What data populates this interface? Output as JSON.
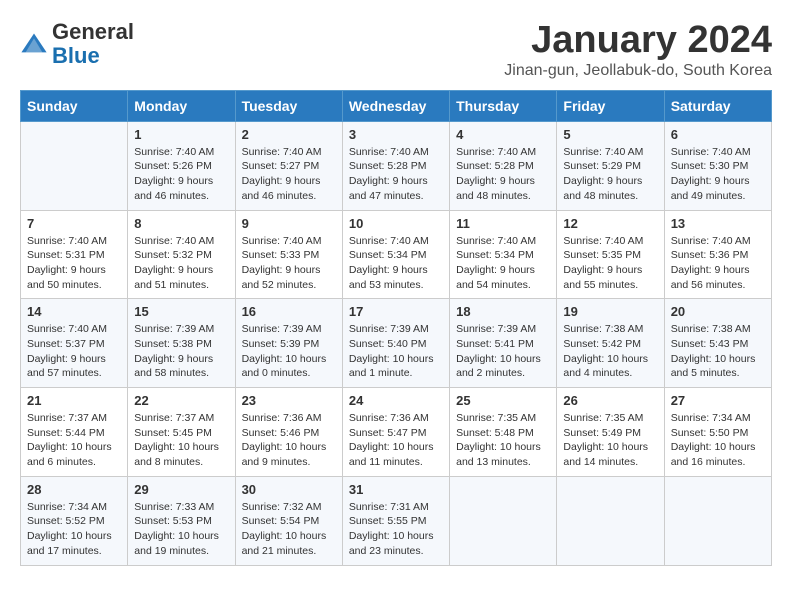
{
  "header": {
    "logo_line1": "General",
    "logo_line2": "Blue",
    "month_title": "January 2024",
    "subtitle": "Jinan-gun, Jeollabuk-do, South Korea"
  },
  "weekdays": [
    "Sunday",
    "Monday",
    "Tuesday",
    "Wednesday",
    "Thursday",
    "Friday",
    "Saturday"
  ],
  "weeks": [
    [
      {
        "day": "",
        "sunrise": "",
        "sunset": "",
        "daylight": ""
      },
      {
        "day": "1",
        "sunrise": "Sunrise: 7:40 AM",
        "sunset": "Sunset: 5:26 PM",
        "daylight": "Daylight: 9 hours and 46 minutes."
      },
      {
        "day": "2",
        "sunrise": "Sunrise: 7:40 AM",
        "sunset": "Sunset: 5:27 PM",
        "daylight": "Daylight: 9 hours and 46 minutes."
      },
      {
        "day": "3",
        "sunrise": "Sunrise: 7:40 AM",
        "sunset": "Sunset: 5:28 PM",
        "daylight": "Daylight: 9 hours and 47 minutes."
      },
      {
        "day": "4",
        "sunrise": "Sunrise: 7:40 AM",
        "sunset": "Sunset: 5:28 PM",
        "daylight": "Daylight: 9 hours and 48 minutes."
      },
      {
        "day": "5",
        "sunrise": "Sunrise: 7:40 AM",
        "sunset": "Sunset: 5:29 PM",
        "daylight": "Daylight: 9 hours and 48 minutes."
      },
      {
        "day": "6",
        "sunrise": "Sunrise: 7:40 AM",
        "sunset": "Sunset: 5:30 PM",
        "daylight": "Daylight: 9 hours and 49 minutes."
      }
    ],
    [
      {
        "day": "7",
        "sunrise": "Sunrise: 7:40 AM",
        "sunset": "Sunset: 5:31 PM",
        "daylight": "Daylight: 9 hours and 50 minutes."
      },
      {
        "day": "8",
        "sunrise": "Sunrise: 7:40 AM",
        "sunset": "Sunset: 5:32 PM",
        "daylight": "Daylight: 9 hours and 51 minutes."
      },
      {
        "day": "9",
        "sunrise": "Sunrise: 7:40 AM",
        "sunset": "Sunset: 5:33 PM",
        "daylight": "Daylight: 9 hours and 52 minutes."
      },
      {
        "day": "10",
        "sunrise": "Sunrise: 7:40 AM",
        "sunset": "Sunset: 5:34 PM",
        "daylight": "Daylight: 9 hours and 53 minutes."
      },
      {
        "day": "11",
        "sunrise": "Sunrise: 7:40 AM",
        "sunset": "Sunset: 5:34 PM",
        "daylight": "Daylight: 9 hours and 54 minutes."
      },
      {
        "day": "12",
        "sunrise": "Sunrise: 7:40 AM",
        "sunset": "Sunset: 5:35 PM",
        "daylight": "Daylight: 9 hours and 55 minutes."
      },
      {
        "day": "13",
        "sunrise": "Sunrise: 7:40 AM",
        "sunset": "Sunset: 5:36 PM",
        "daylight": "Daylight: 9 hours and 56 minutes."
      }
    ],
    [
      {
        "day": "14",
        "sunrise": "Sunrise: 7:40 AM",
        "sunset": "Sunset: 5:37 PM",
        "daylight": "Daylight: 9 hours and 57 minutes."
      },
      {
        "day": "15",
        "sunrise": "Sunrise: 7:39 AM",
        "sunset": "Sunset: 5:38 PM",
        "daylight": "Daylight: 9 hours and 58 minutes."
      },
      {
        "day": "16",
        "sunrise": "Sunrise: 7:39 AM",
        "sunset": "Sunset: 5:39 PM",
        "daylight": "Daylight: 10 hours and 0 minutes."
      },
      {
        "day": "17",
        "sunrise": "Sunrise: 7:39 AM",
        "sunset": "Sunset: 5:40 PM",
        "daylight": "Daylight: 10 hours and 1 minute."
      },
      {
        "day": "18",
        "sunrise": "Sunrise: 7:39 AM",
        "sunset": "Sunset: 5:41 PM",
        "daylight": "Daylight: 10 hours and 2 minutes."
      },
      {
        "day": "19",
        "sunrise": "Sunrise: 7:38 AM",
        "sunset": "Sunset: 5:42 PM",
        "daylight": "Daylight: 10 hours and 4 minutes."
      },
      {
        "day": "20",
        "sunrise": "Sunrise: 7:38 AM",
        "sunset": "Sunset: 5:43 PM",
        "daylight": "Daylight: 10 hours and 5 minutes."
      }
    ],
    [
      {
        "day": "21",
        "sunrise": "Sunrise: 7:37 AM",
        "sunset": "Sunset: 5:44 PM",
        "daylight": "Daylight: 10 hours and 6 minutes."
      },
      {
        "day": "22",
        "sunrise": "Sunrise: 7:37 AM",
        "sunset": "Sunset: 5:45 PM",
        "daylight": "Daylight: 10 hours and 8 minutes."
      },
      {
        "day": "23",
        "sunrise": "Sunrise: 7:36 AM",
        "sunset": "Sunset: 5:46 PM",
        "daylight": "Daylight: 10 hours and 9 minutes."
      },
      {
        "day": "24",
        "sunrise": "Sunrise: 7:36 AM",
        "sunset": "Sunset: 5:47 PM",
        "daylight": "Daylight: 10 hours and 11 minutes."
      },
      {
        "day": "25",
        "sunrise": "Sunrise: 7:35 AM",
        "sunset": "Sunset: 5:48 PM",
        "daylight": "Daylight: 10 hours and 13 minutes."
      },
      {
        "day": "26",
        "sunrise": "Sunrise: 7:35 AM",
        "sunset": "Sunset: 5:49 PM",
        "daylight": "Daylight: 10 hours and 14 minutes."
      },
      {
        "day": "27",
        "sunrise": "Sunrise: 7:34 AM",
        "sunset": "Sunset: 5:50 PM",
        "daylight": "Daylight: 10 hours and 16 minutes."
      }
    ],
    [
      {
        "day": "28",
        "sunrise": "Sunrise: 7:34 AM",
        "sunset": "Sunset: 5:52 PM",
        "daylight": "Daylight: 10 hours and 17 minutes."
      },
      {
        "day": "29",
        "sunrise": "Sunrise: 7:33 AM",
        "sunset": "Sunset: 5:53 PM",
        "daylight": "Daylight: 10 hours and 19 minutes."
      },
      {
        "day": "30",
        "sunrise": "Sunrise: 7:32 AM",
        "sunset": "Sunset: 5:54 PM",
        "daylight": "Daylight: 10 hours and 21 minutes."
      },
      {
        "day": "31",
        "sunrise": "Sunrise: 7:31 AM",
        "sunset": "Sunset: 5:55 PM",
        "daylight": "Daylight: 10 hours and 23 minutes."
      },
      {
        "day": "",
        "sunrise": "",
        "sunset": "",
        "daylight": ""
      },
      {
        "day": "",
        "sunrise": "",
        "sunset": "",
        "daylight": ""
      },
      {
        "day": "",
        "sunrise": "",
        "sunset": "",
        "daylight": ""
      }
    ]
  ]
}
